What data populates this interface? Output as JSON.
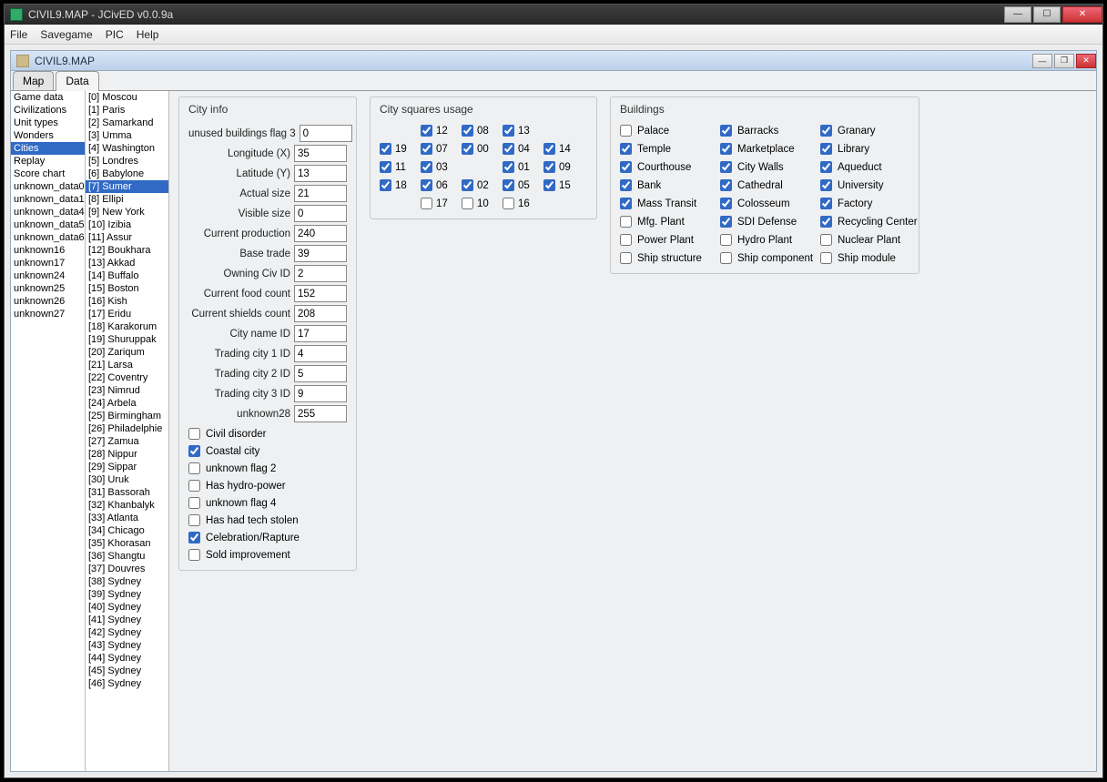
{
  "outer_title": "CIVIL9.MAP - JCivED v0.0.9a",
  "inner_title": "CIVIL9.MAP",
  "menu": {
    "file": "File",
    "savegame": "Savegame",
    "pic": "PIC",
    "help": "Help"
  },
  "tabs": {
    "map": "Map",
    "data": "Data"
  },
  "left_list": {
    "items": [
      "Game data",
      "Civilizations",
      "Unit types",
      "Wonders",
      "Cities",
      "Replay",
      "Score chart",
      "unknown_data0",
      "unknown_data1",
      "unknown_data4",
      "unknown_data5",
      "unknown_data6",
      "unknown16",
      "unknown17",
      "unknown24",
      "unknown25",
      "unknown26",
      "unknown27"
    ],
    "selected_index": 4
  },
  "city_list": {
    "items": [
      "[0] Moscou",
      "[1] Paris",
      "[2] Samarkand",
      "[3] Umma",
      "[4] Washington",
      "[5] Londres",
      "[6] Babylone",
      "[7] Sumer",
      "[8] Ellipi",
      "[9] New York",
      "[10] Izibia",
      "[11] Assur",
      "[12] Boukhara",
      "[13] Akkad",
      "[14] Buffalo",
      "[15] Boston",
      "[16] Kish",
      "[17] Eridu",
      "[18] Karakorum",
      "[19] Shuruppak",
      "[20] Zariqum",
      "[21] Larsa",
      "[22] Coventry",
      "[23] Nimrud",
      "[24] Arbela",
      "[25] Birmingham",
      "[26] Philadelphie",
      "[27] Zamua",
      "[28] Nippur",
      "[29] Sippar",
      "[30] Uruk",
      "[31] Bassorah",
      "[32] Khanbalyk",
      "[33] Atlanta",
      "[34] Chicago",
      "[35] Khorasan",
      "[36] Shangtu",
      "[37] Douvres",
      "[38] Sydney",
      "[39] Sydney",
      "[40] Sydney",
      "[41] Sydney",
      "[42] Sydney",
      "[43] Sydney",
      "[44] Sydney",
      "[45] Sydney",
      "[46] Sydney"
    ],
    "selected_index": 7
  },
  "cityinfo": {
    "title": "City info",
    "fields": [
      {
        "label": "unused buildings flag 3",
        "value": "0"
      },
      {
        "label": "Longitude (X)",
        "value": "35"
      },
      {
        "label": "Latitude (Y)",
        "value": "13"
      },
      {
        "label": "Actual size",
        "value": "21"
      },
      {
        "label": "Visible size",
        "value": "0"
      },
      {
        "label": "Current production",
        "value": "240"
      },
      {
        "label": "Base trade",
        "value": "39"
      },
      {
        "label": "Owning Civ ID",
        "value": "2"
      },
      {
        "label": "Current food count",
        "value": "152"
      },
      {
        "label": "Current shields count",
        "value": "208"
      },
      {
        "label": "City name ID",
        "value": "17"
      },
      {
        "label": "Trading city 1 ID",
        "value": "4"
      },
      {
        "label": "Trading city 2 ID",
        "value": "5"
      },
      {
        "label": "Trading city 3 ID",
        "value": "9"
      },
      {
        "label": "unknown28",
        "value": "255"
      }
    ],
    "flags": [
      {
        "label": "Civil disorder",
        "checked": false
      },
      {
        "label": "Coastal city",
        "checked": true
      },
      {
        "label": "unknown flag 2",
        "checked": false
      },
      {
        "label": "Has hydro-power",
        "checked": false
      },
      {
        "label": "unknown flag 4",
        "checked": false
      },
      {
        "label": "Has had tech stolen",
        "checked": false
      },
      {
        "label": "Celebration/Rapture",
        "checked": true
      },
      {
        "label": "Sold improvement",
        "checked": false
      }
    ]
  },
  "squares": {
    "title": "City squares usage",
    "cells": [
      {
        "n": "",
        "show": false
      },
      {
        "n": "12",
        "c": true
      },
      {
        "n": "08",
        "c": true
      },
      {
        "n": "13",
        "c": true
      },
      {
        "n": "",
        "show": false
      },
      {
        "n": "19",
        "c": true
      },
      {
        "n": "07",
        "c": true
      },
      {
        "n": "00",
        "c": true
      },
      {
        "n": "04",
        "c": true
      },
      {
        "n": "14",
        "c": true
      },
      {
        "n": "11",
        "c": true
      },
      {
        "n": "03",
        "c": true
      },
      {
        "n": "",
        "show": false
      },
      {
        "n": "01",
        "c": true
      },
      {
        "n": "09",
        "c": true
      },
      {
        "n": "18",
        "c": true
      },
      {
        "n": "06",
        "c": true
      },
      {
        "n": "02",
        "c": true
      },
      {
        "n": "05",
        "c": true
      },
      {
        "n": "15",
        "c": true
      },
      {
        "n": "",
        "show": false
      },
      {
        "n": "17",
        "c": false
      },
      {
        "n": "10",
        "c": false
      },
      {
        "n": "16",
        "c": false
      },
      {
        "n": "",
        "show": false
      }
    ]
  },
  "buildings": {
    "title": "Buildings",
    "items": [
      {
        "label": "Palace",
        "c": false
      },
      {
        "label": "Barracks",
        "c": true
      },
      {
        "label": "Granary",
        "c": true
      },
      {
        "label": "Temple",
        "c": true
      },
      {
        "label": "Marketplace",
        "c": true
      },
      {
        "label": "Library",
        "c": true
      },
      {
        "label": "Courthouse",
        "c": true
      },
      {
        "label": "City Walls",
        "c": true
      },
      {
        "label": "Aqueduct",
        "c": true
      },
      {
        "label": "Bank",
        "c": true
      },
      {
        "label": "Cathedral",
        "c": true
      },
      {
        "label": "University",
        "c": true
      },
      {
        "label": "Mass Transit",
        "c": true
      },
      {
        "label": "Colosseum",
        "c": true
      },
      {
        "label": "Factory",
        "c": true
      },
      {
        "label": "Mfg. Plant",
        "c": false
      },
      {
        "label": "SDI Defense",
        "c": true
      },
      {
        "label": "Recycling Center",
        "c": true
      },
      {
        "label": "Power Plant",
        "c": false
      },
      {
        "label": "Hydro Plant",
        "c": false
      },
      {
        "label": "Nuclear Plant",
        "c": false
      },
      {
        "label": "Ship structure",
        "c": false
      },
      {
        "label": "Ship component",
        "c": false
      },
      {
        "label": "Ship module",
        "c": false
      }
    ]
  }
}
